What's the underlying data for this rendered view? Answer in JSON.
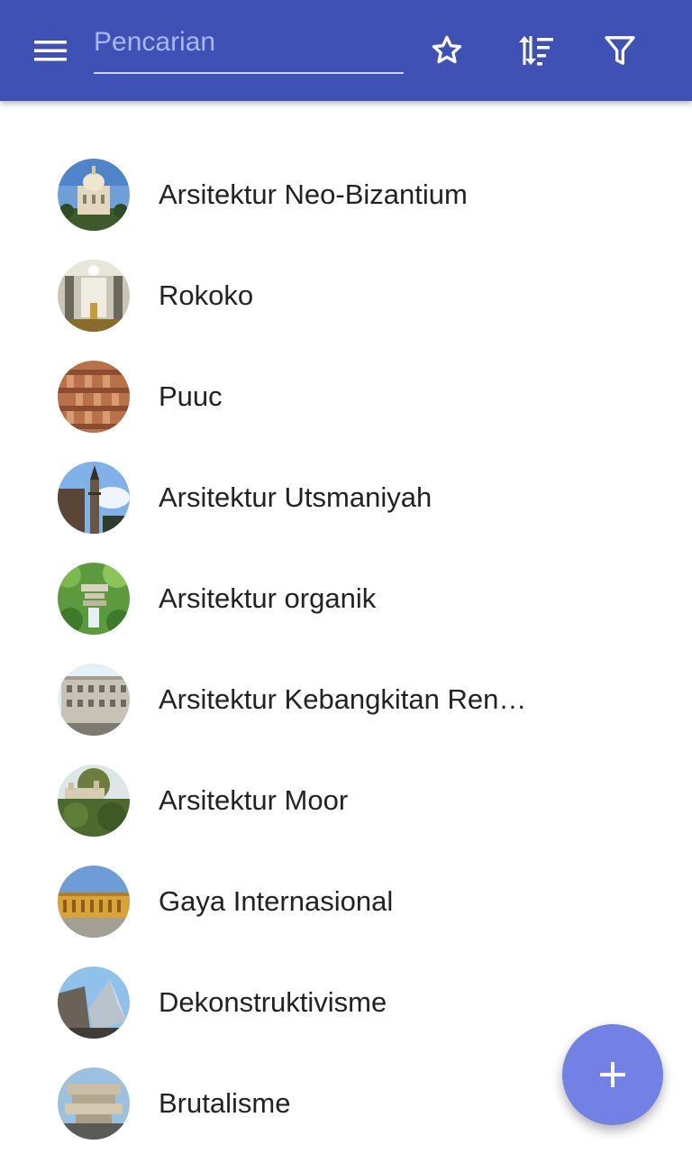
{
  "appbar": {
    "background": "#3f51b5",
    "menu_icon": "menu-icon",
    "search": {
      "placeholder": "Pencarian",
      "value": ""
    },
    "actions": [
      "star-icon",
      "sort-icon",
      "filter-icon"
    ]
  },
  "list": {
    "items": [
      {
        "label": "Arsitektur Neo-Bizantium",
        "thumbnail": "neo-byzantine-church-photo"
      },
      {
        "label": "Rokoko",
        "thumbnail": "rococo-interior-photo"
      },
      {
        "label": "Puuc",
        "thumbnail": "puuc-stone-facade-photo"
      },
      {
        "label": "Arsitektur Utsmaniyah",
        "thumbnail": "ottoman-minaret-photo"
      },
      {
        "label": "Arsitektur organik",
        "thumbnail": "organic-house-waterfall-photo"
      },
      {
        "label": "Arsitektur Kebangkitan Ren…",
        "thumbnail": "renaissance-revival-building-photo"
      },
      {
        "label": "Arsitektur Moor",
        "thumbnail": "moorish-hill-palace-photo"
      },
      {
        "label": "Gaya Internasional",
        "thumbnail": "international-style-building-photo"
      },
      {
        "label": "Dekonstruktivisme",
        "thumbnail": "deconstructivist-building-photo"
      },
      {
        "label": "Brutalisme",
        "thumbnail": "brutalist-building-photo"
      }
    ]
  },
  "fab": {
    "icon": "plus-icon",
    "color": "#7380e4"
  }
}
